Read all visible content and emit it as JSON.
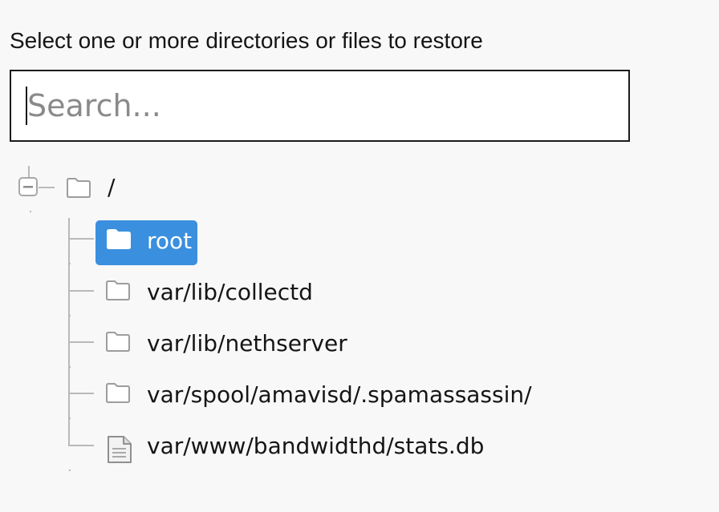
{
  "prompt": "Select one or more directories or files to restore",
  "search": {
    "placeholder": "Search...",
    "value": ""
  },
  "colors": {
    "selected_background": "#3a8fde",
    "tree_line": "#b9b9b9"
  },
  "tree": {
    "root": {
      "label": "/",
      "icon": "folder-outline-icon",
      "expanded": true
    },
    "children": [
      {
        "label": "root",
        "icon": "folder-solid-icon",
        "selected": true
      },
      {
        "label": "var/lib/collectd",
        "icon": "folder-outline-icon",
        "selected": false
      },
      {
        "label": "var/lib/nethserver",
        "icon": "folder-outline-icon",
        "selected": false
      },
      {
        "label": "var/spool/amavisd/.spamassassin/",
        "icon": "folder-outline-icon",
        "selected": false
      },
      {
        "label": "var/www/bandwidthd/stats.db",
        "icon": "file-icon",
        "selected": false
      }
    ]
  }
}
